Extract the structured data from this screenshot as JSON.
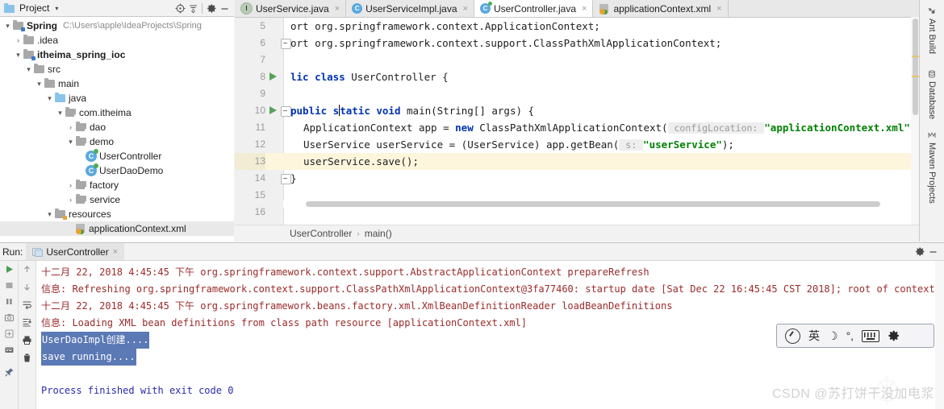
{
  "project_panel": {
    "title": "Project",
    "caret": "▾",
    "icons": {
      "locate": "locate-icon",
      "collapse": "collapse-all-icon",
      "settings": "gear-icon",
      "hide": "minimize-icon"
    },
    "tree": [
      {
        "indent": 0,
        "arrow": "▾",
        "icon": "module-folder",
        "label": "Spring",
        "bold": true,
        "path": "C:\\Users\\apple\\IdeaProjects\\Spring",
        "selected": false
      },
      {
        "indent": 1,
        "arrow": "›",
        "icon": "folder",
        "label": ".idea",
        "bold": false,
        "path": "",
        "selected": false
      },
      {
        "indent": 1,
        "arrow": "▾",
        "icon": "module-folder",
        "label": "itheima_spring_ioc",
        "bold": true,
        "path": "",
        "selected": false
      },
      {
        "indent": 2,
        "arrow": "▾",
        "icon": "folder",
        "label": "src",
        "bold": false,
        "path": "",
        "selected": false
      },
      {
        "indent": 3,
        "arrow": "▾",
        "icon": "folder",
        "label": "main",
        "bold": false,
        "path": "",
        "selected": false
      },
      {
        "indent": 4,
        "arrow": "▾",
        "icon": "source-folder",
        "label": "java",
        "bold": false,
        "path": "",
        "selected": false
      },
      {
        "indent": 5,
        "arrow": "▾",
        "icon": "package-folder",
        "label": "com.itheima",
        "bold": false,
        "path": "",
        "selected": false
      },
      {
        "indent": 6,
        "arrow": "›",
        "icon": "package-folder",
        "label": "dao",
        "bold": false,
        "path": "",
        "selected": false
      },
      {
        "indent": 6,
        "arrow": "▾",
        "icon": "package-folder",
        "label": "demo",
        "bold": false,
        "path": "",
        "selected": false
      },
      {
        "indent": 7,
        "arrow": "",
        "icon": "java-class-runnable",
        "label": "UserController",
        "bold": false,
        "path": "",
        "selected": false
      },
      {
        "indent": 7,
        "arrow": "",
        "icon": "java-class-runnable",
        "label": "UserDaoDemo",
        "bold": false,
        "path": "",
        "selected": false
      },
      {
        "indent": 6,
        "arrow": "›",
        "icon": "package-folder",
        "label": "factory",
        "bold": false,
        "path": "",
        "selected": false
      },
      {
        "indent": 6,
        "arrow": "›",
        "icon": "package-folder",
        "label": "service",
        "bold": false,
        "path": "",
        "selected": false
      },
      {
        "indent": 4,
        "arrow": "▾",
        "icon": "resource-folder",
        "label": "resources",
        "bold": false,
        "path": "",
        "selected": false
      },
      {
        "indent": 6,
        "arrow": "",
        "icon": "xml-spring",
        "label": "applicationContext.xml",
        "bold": false,
        "path": "",
        "selected": true
      }
    ]
  },
  "editor": {
    "tabs": [
      {
        "label": "UserService.java",
        "icon": "java-interface",
        "active": false,
        "close": "×"
      },
      {
        "label": "UserServiceImpl.java",
        "icon": "java-class",
        "active": false,
        "close": "×"
      },
      {
        "label": "UserController.java",
        "icon": "java-class-runnable",
        "active": true,
        "close": "×"
      },
      {
        "label": "applicationContext.xml",
        "icon": "xml-spring",
        "active": false,
        "close": "×"
      }
    ],
    "lines": [
      {
        "num": "5",
        "run": false,
        "fold": "",
        "highlight": false,
        "segments": [
          {
            "t": "plain",
            "v": "ort org.springframework.context.ApplicationContext;"
          }
        ]
      },
      {
        "num": "6",
        "run": false,
        "fold": "minus",
        "highlight": false,
        "segments": [
          {
            "t": "plain",
            "v": "ort org.springframework.context.support.ClassPathXmlApplicationContext;"
          }
        ]
      },
      {
        "num": "7",
        "run": false,
        "fold": "",
        "highlight": false,
        "segments": []
      },
      {
        "num": "8",
        "run": true,
        "fold": "",
        "highlight": false,
        "segments": [
          {
            "t": "kw",
            "v": "lic class "
          },
          {
            "t": "plain",
            "v": "UserController {"
          }
        ]
      },
      {
        "num": "9",
        "run": false,
        "fold": "",
        "highlight": false,
        "segments": []
      },
      {
        "num": "10",
        "run": true,
        "fold": "minus",
        "highlight": false,
        "segments": [
          {
            "t": "kw",
            "v": "public s"
          },
          {
            "t": "caret",
            "v": ""
          },
          {
            "t": "kw",
            "v": "tatic void "
          },
          {
            "t": "plain",
            "v": "main(String[] args) {"
          }
        ]
      },
      {
        "num": "11",
        "run": false,
        "fold": "",
        "highlight": false,
        "indent": 2,
        "segments": [
          {
            "t": "plain",
            "v": "ApplicationContext app = "
          },
          {
            "t": "kw",
            "v": "new "
          },
          {
            "t": "plain",
            "v": "ClassPathXmlApplicationContext("
          },
          {
            "t": "hint",
            "v": " configLocation: "
          },
          {
            "t": "str",
            "v": "\"applicationContext.xml\""
          },
          {
            "t": "plain",
            "v": ");"
          }
        ]
      },
      {
        "num": "12",
        "run": false,
        "fold": "",
        "highlight": false,
        "indent": 2,
        "segments": [
          {
            "t": "plain",
            "v": "UserService userService = (UserService) app.getBean("
          },
          {
            "t": "hint",
            "v": " s: "
          },
          {
            "t": "str",
            "v": "\"userService\""
          },
          {
            "t": "plain",
            "v": ");"
          }
        ]
      },
      {
        "num": "13",
        "run": false,
        "fold": "",
        "highlight": true,
        "indent": 2,
        "segments": [
          {
            "t": "plain",
            "v": "userService.save();"
          }
        ]
      },
      {
        "num": "14",
        "run": false,
        "fold": "minus",
        "highlight": false,
        "segments": [
          {
            "t": "plain",
            "v": "}"
          }
        ]
      },
      {
        "num": "15",
        "run": false,
        "fold": "",
        "highlight": false,
        "segments": []
      },
      {
        "num": "16",
        "run": false,
        "fold": "",
        "highlight": false,
        "segments": []
      }
    ],
    "breadcrumb": [
      "UserController",
      "main()"
    ],
    "breadcrumb_sep": "›"
  },
  "right_strip": [
    {
      "label": "Ant Build",
      "icon": "ant-icon"
    },
    {
      "label": "Database",
      "icon": "database-icon"
    },
    {
      "label": "Maven Projects",
      "icon": "maven-icon"
    }
  ],
  "run_panel": {
    "label": "Run:",
    "tab": {
      "label": "UserController",
      "close": "×",
      "icon": "run-config-icon"
    },
    "header_icons": {
      "settings": "gear-icon",
      "hide": "minimize-icon"
    },
    "left_toolbar": [
      {
        "icon": "rerun-icon",
        "name": "rerun-button"
      },
      {
        "icon": "stop-icon",
        "name": "stop-button"
      },
      {
        "icon": "pause-icon",
        "name": "pause-button"
      },
      {
        "icon": "camera-icon",
        "name": "dump-threads-button"
      },
      {
        "icon": "export-icon",
        "name": "export-button"
      },
      {
        "icon": "console-icon",
        "name": "console-toggle-button"
      },
      {
        "icon": "pin-icon",
        "name": "pin-tab-button"
      }
    ],
    "left_toolbar_2": [
      {
        "icon": "arrow-up-icon",
        "name": "prev-occurrence-button"
      },
      {
        "icon": "arrow-down-icon",
        "name": "next-occurrence-button"
      },
      {
        "icon": "soft-wrap-icon",
        "name": "soft-wrap-button"
      },
      {
        "icon": "scroll-to-end-icon",
        "name": "scroll-to-end-button"
      },
      {
        "icon": "print-icon",
        "name": "print-button"
      },
      {
        "icon": "trash-icon",
        "name": "clear-all-button"
      }
    ],
    "console": [
      {
        "style": "red",
        "text": "十二月 22, 2018 4:45:45 下午 org.springframework.context.support.AbstractApplicationContext prepareRefresh",
        "selected": false
      },
      {
        "style": "red",
        "text": "信息: Refreshing org.springframework.context.support.ClassPathXmlApplicationContext@3fa77460: startup date [Sat Dec 22 16:45:45 CST 2018]; root of context h",
        "selected": false
      },
      {
        "style": "red",
        "text": "十二月 22, 2018 4:45:45 下午 org.springframework.beans.factory.xml.XmlBeanDefinitionReader loadBeanDefinitions",
        "selected": false
      },
      {
        "style": "red",
        "text": "信息: Loading XML bean definitions from class path resource [applicationContext.xml]",
        "selected": false
      },
      {
        "style": "plain",
        "text": "UserDaoImpl创建....",
        "selected": true
      },
      {
        "style": "plain",
        "text": "save running....",
        "selected": true
      },
      {
        "style": "plain",
        "text": "",
        "selected": false
      },
      {
        "style": "blue",
        "text": "Process finished with exit code 0",
        "selected": false
      }
    ]
  },
  "ime_bar": {
    "items": [
      {
        "icon": "sogou-logo-icon",
        "label": ""
      },
      {
        "icon": "lang-mode-icon",
        "label": "英"
      },
      {
        "icon": "moon-icon",
        "label": "☽"
      },
      {
        "icon": "punctuation-icon",
        "label": "°,"
      },
      {
        "icon": "keyboard-icon",
        "label": ""
      },
      {
        "icon": "gear-icon",
        "label": ""
      }
    ]
  },
  "watermark": {
    "text": "CSDN @苏打饼干没加电浆"
  },
  "colors": {
    "keyword": "#0033b3",
    "string": "#008000",
    "console_red": "#9b2a2a",
    "console_blue": "#2b2bab",
    "selection": "#5b79b5",
    "highlight_line": "#fdf6dd",
    "run_marker_green": "#57a05a"
  }
}
